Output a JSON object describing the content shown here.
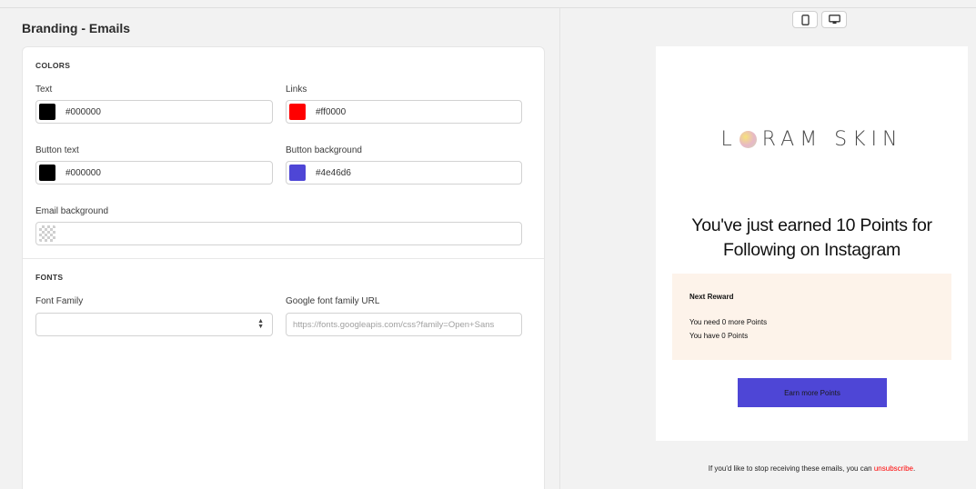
{
  "page": {
    "title": "Branding - Emails"
  },
  "colors": {
    "section_title": "COLORS",
    "text": {
      "label": "Text",
      "value": "#000000",
      "swatch": "#000000"
    },
    "links": {
      "label": "Links",
      "value": "#ff0000",
      "swatch": "#ff0000"
    },
    "button_text": {
      "label": "Button text",
      "value": "#000000",
      "swatch": "#000000"
    },
    "button_background": {
      "label": "Button background",
      "value": "#4e46d6",
      "swatch": "#4e46d6"
    },
    "email_background": {
      "label": "Email background",
      "value": ""
    }
  },
  "fonts": {
    "section_title": "FONTS",
    "font_family": {
      "label": "Font Family",
      "value": ""
    },
    "google_font_url": {
      "label": "Google font family URL",
      "placeholder": "https://fonts.googleapis.com/css?family=Open+Sans"
    }
  },
  "preview": {
    "device_buttons": [
      "mobile-icon",
      "desktop-icon"
    ],
    "brand_left": "L",
    "brand_right": "RAM SKIN",
    "headline_line1": "You've just earned 10 Points for",
    "headline_line2": "Following on Instagram",
    "reward": {
      "title": "Next Reward",
      "need": "You need 0 more Points",
      "have": "You have 0 Points"
    },
    "cta_label": "Earn more Points",
    "footer_text": "If you'd like to stop receiving these emails, you can",
    "unsubscribe_label": "unsubscribe",
    "footer_end": "."
  },
  "theme": {
    "accent": "#4e46d6",
    "link": "#ff0000",
    "reward_bg": "#fdf3ea"
  }
}
